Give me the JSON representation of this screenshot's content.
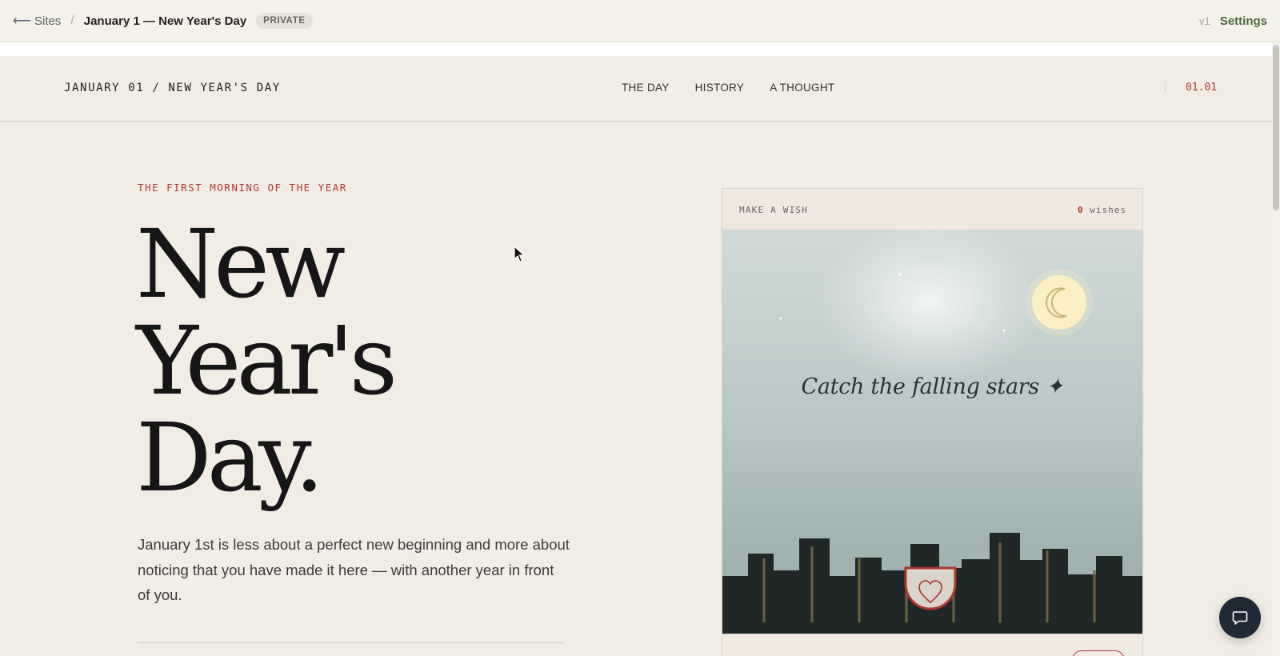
{
  "appbar": {
    "back_label": "Sites",
    "separator": "/",
    "title": "January 1 — New Year's Day",
    "badge": "PRIVATE",
    "version": "v1",
    "settings_label": "Settings"
  },
  "sitenav": {
    "brand": "JANUARY 01 / NEW YEAR'S DAY",
    "links": [
      "THE DAY",
      "HISTORY",
      "A THOUGHT"
    ],
    "date": "01.01"
  },
  "hero": {
    "kicker": "THE FIRST MORNING OF THE YEAR",
    "title_lines": [
      "New",
      "Year's",
      "Day."
    ],
    "lede": "January 1st is less about a perfect new beginning and more about noticing that you have made it here — with another year in front of you."
  },
  "wish_card": {
    "label": "MAKE A WISH",
    "count": "0",
    "count_unit": "wishes",
    "caption": "Catch the falling stars ✦"
  },
  "colors": {
    "accent": "#b43a32",
    "settings": "#4c6a3f",
    "background": "#f1ede5",
    "city": "#1f2826",
    "moon": "#fbefc4"
  },
  "icons": [
    "back-arrow-icon",
    "moon-icon",
    "sparkle-icon",
    "heart-icon",
    "chat-icon",
    "cursor-icon"
  ]
}
